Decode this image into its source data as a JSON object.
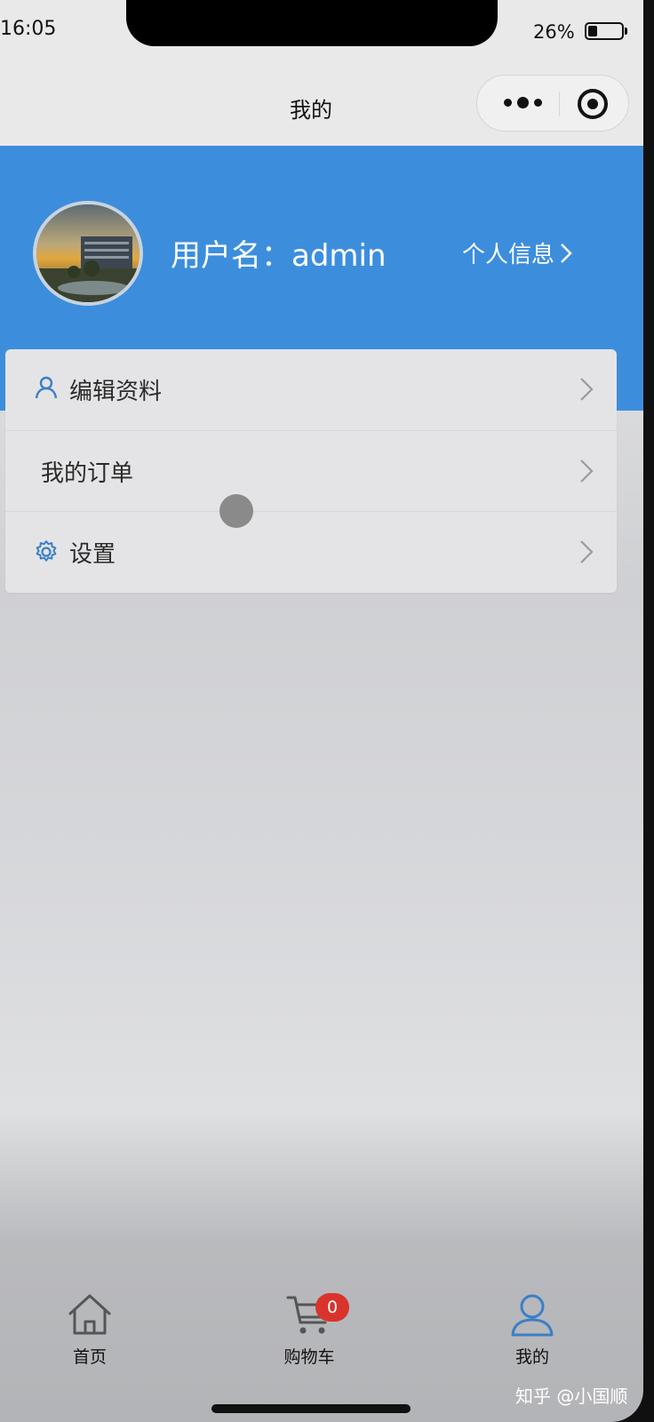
{
  "status_bar": {
    "time": "16:05",
    "battery": "26%"
  },
  "nav": {
    "title": "我的"
  },
  "profile": {
    "username": "用户名：admin",
    "info_link": "个人信息"
  },
  "menu": [
    {
      "label": "编辑资料",
      "icon": "user-icon"
    },
    {
      "label": "我的订单",
      "icon": ""
    },
    {
      "label": "设置",
      "icon": "gear-icon"
    }
  ],
  "tabbar": {
    "items": [
      {
        "label": "首页",
        "icon": "home-icon"
      },
      {
        "label": "购物车",
        "icon": "cart-icon",
        "badge": "0"
      },
      {
        "label": "我的",
        "icon": "user-icon",
        "active": true
      }
    ]
  },
  "watermark": "知乎 @小国顺",
  "colors": {
    "accent": "#3c8edc",
    "badge": "#d9342b",
    "icon_blue": "#3a7fc6"
  }
}
